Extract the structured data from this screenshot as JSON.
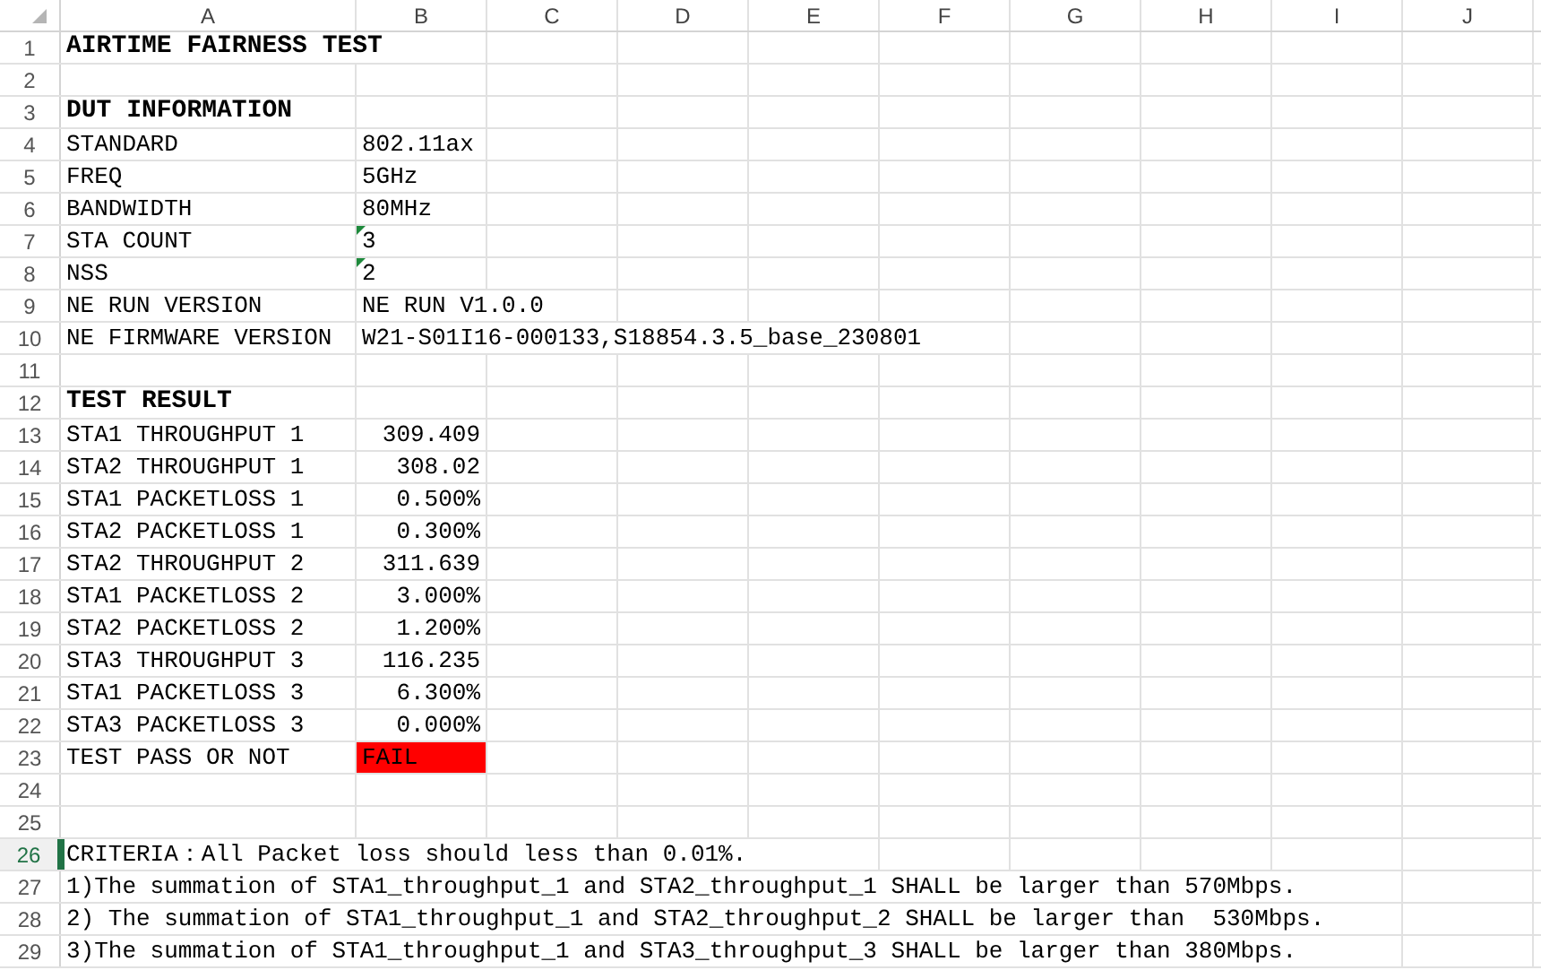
{
  "columns": [
    "A",
    "B",
    "C",
    "D",
    "E",
    "F",
    "G",
    "H",
    "I",
    "J"
  ],
  "rows": [
    {
      "number": "1",
      "selected": false,
      "cells": [
        {
          "kind": "heading",
          "text": "AIRTIME FAIRNESS TEST"
        }
      ]
    },
    {
      "number": "2",
      "selected": false,
      "cells": []
    },
    {
      "number": "3",
      "selected": false,
      "cells": [
        {
          "kind": "heading",
          "text": "DUT INFORMATION"
        }
      ]
    },
    {
      "number": "4",
      "selected": false,
      "cells": [
        {
          "kind": "text",
          "text": "STANDARD"
        },
        {
          "kind": "text",
          "text": "802.11ax"
        }
      ]
    },
    {
      "number": "5",
      "selected": false,
      "cells": [
        {
          "kind": "text",
          "text": "FREQ"
        },
        {
          "kind": "text",
          "text": "5GHz"
        }
      ]
    },
    {
      "number": "6",
      "selected": false,
      "cells": [
        {
          "kind": "text",
          "text": "BANDWIDTH"
        },
        {
          "kind": "text",
          "text": "80MHz"
        }
      ]
    },
    {
      "number": "7",
      "selected": false,
      "cells": [
        {
          "kind": "text",
          "text": "STA COUNT"
        },
        {
          "kind": "text",
          "text": "3",
          "error_marker": true
        }
      ]
    },
    {
      "number": "8",
      "selected": false,
      "cells": [
        {
          "kind": "text",
          "text": "NSS"
        },
        {
          "kind": "text",
          "text": "2",
          "error_marker": true
        }
      ]
    },
    {
      "number": "9",
      "selected": false,
      "cells": [
        {
          "kind": "text",
          "text": "NE RUN VERSION"
        },
        {
          "kind": "text",
          "text": "NE RUN V1.0.0"
        }
      ]
    },
    {
      "number": "10",
      "selected": false,
      "cells": [
        {
          "kind": "text",
          "text": "NE FIRMWARE VERSION"
        },
        {
          "kind": "text",
          "text": "W21-S01I16-000133,S18854.3.5_base_230801"
        }
      ]
    },
    {
      "number": "11",
      "selected": false,
      "cells": []
    },
    {
      "number": "12",
      "selected": false,
      "cells": [
        {
          "kind": "heading",
          "text": "TEST RESULT"
        }
      ]
    },
    {
      "number": "13",
      "selected": false,
      "cells": [
        {
          "kind": "text",
          "text": "STA1 THROUGHPUT 1"
        },
        {
          "kind": "number",
          "text": "309.409"
        }
      ]
    },
    {
      "number": "14",
      "selected": false,
      "cells": [
        {
          "kind": "text",
          "text": "STA2 THROUGHPUT 1"
        },
        {
          "kind": "number",
          "text": "308.02"
        }
      ]
    },
    {
      "number": "15",
      "selected": false,
      "cells": [
        {
          "kind": "text",
          "text": "STA1 PACKETLOSS 1"
        },
        {
          "kind": "number",
          "text": "0.500%"
        }
      ]
    },
    {
      "number": "16",
      "selected": false,
      "cells": [
        {
          "kind": "text",
          "text": "STA2 PACKETLOSS 1"
        },
        {
          "kind": "number",
          "text": "0.300%"
        }
      ]
    },
    {
      "number": "17",
      "selected": false,
      "cells": [
        {
          "kind": "text",
          "text": "STA2 THROUGHPUT 2"
        },
        {
          "kind": "number",
          "text": "311.639"
        }
      ]
    },
    {
      "number": "18",
      "selected": false,
      "cells": [
        {
          "kind": "text",
          "text": "STA1 PACKETLOSS 2"
        },
        {
          "kind": "number",
          "text": "3.000%"
        }
      ]
    },
    {
      "number": "19",
      "selected": false,
      "cells": [
        {
          "kind": "text",
          "text": "STA2 PACKETLOSS 2"
        },
        {
          "kind": "number",
          "text": "1.200%"
        }
      ]
    },
    {
      "number": "20",
      "selected": false,
      "cells": [
        {
          "kind": "text",
          "text": "STA3 THROUGHPUT 3"
        },
        {
          "kind": "number",
          "text": "116.235"
        }
      ]
    },
    {
      "number": "21",
      "selected": false,
      "cells": [
        {
          "kind": "text",
          "text": "STA1 PACKETLOSS 3"
        },
        {
          "kind": "number",
          "text": "6.300%"
        }
      ]
    },
    {
      "number": "22",
      "selected": false,
      "cells": [
        {
          "kind": "text",
          "text": "STA3 PACKETLOSS 3"
        },
        {
          "kind": "number",
          "text": "0.000%"
        }
      ]
    },
    {
      "number": "23",
      "selected": false,
      "cells": [
        {
          "kind": "text",
          "text": "TEST PASS OR NOT"
        },
        {
          "kind": "result",
          "text": "FAIL",
          "color": "#ff0000"
        }
      ]
    },
    {
      "number": "24",
      "selected": false,
      "cells": []
    },
    {
      "number": "25",
      "selected": false,
      "cells": []
    },
    {
      "number": "26",
      "selected": true,
      "cells": [
        {
          "kind": "text",
          "text": "CRITERIA：All Packet loss should less than 0.01%.",
          "active": true
        }
      ]
    },
    {
      "number": "27",
      "selected": false,
      "cells": [
        {
          "kind": "text",
          "text": "1)The summation of STA1_throughput_1 and STA2_throughput_1 SHALL be larger than 570Mbps."
        }
      ]
    },
    {
      "number": "28",
      "selected": false,
      "cells": [
        {
          "kind": "text",
          "text": "2) The summation of STA1_throughput_1 and STA2_throughput_2 SHALL be larger than  530Mbps."
        }
      ]
    },
    {
      "number": "29",
      "selected": false,
      "cells": [
        {
          "kind": "text",
          "text": "3)The summation of STA1_throughput_1 and STA3_throughput_3 SHALL be larger than 380Mbps."
        }
      ]
    }
  ]
}
